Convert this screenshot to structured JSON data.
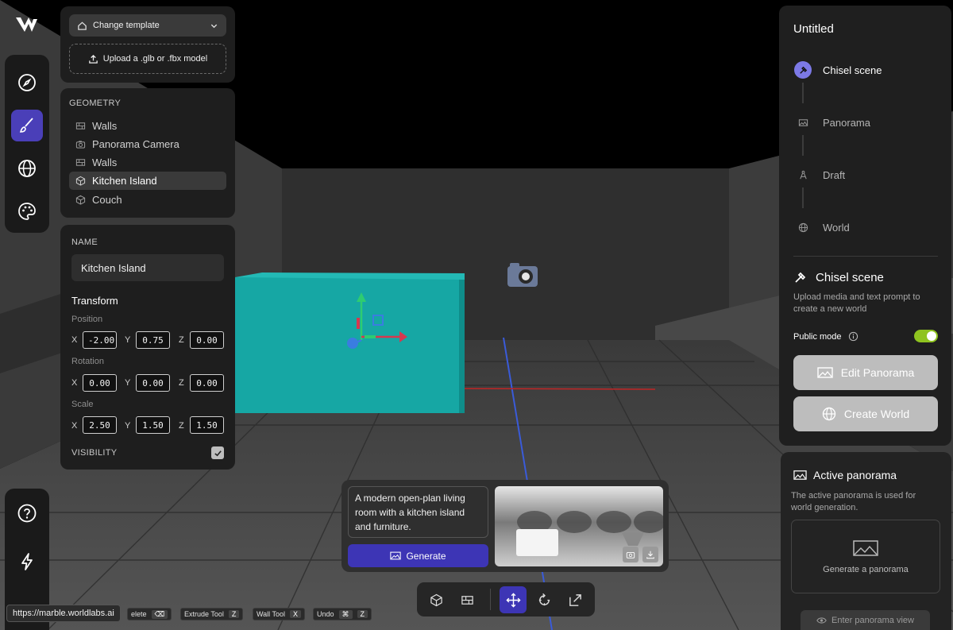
{
  "app": {
    "logo_icon": "worldlabs-logo-icon",
    "status_url": "https://marble.worldlabs.ai"
  },
  "rail_top": {
    "items": [
      {
        "icon": "compass-icon",
        "active": false
      },
      {
        "icon": "brush-icon",
        "active": true
      },
      {
        "icon": "globe-icon",
        "active": false
      },
      {
        "icon": "palette-icon",
        "active": false
      }
    ]
  },
  "rail_bottom": {
    "items": [
      {
        "icon": "help-icon"
      },
      {
        "icon": "lightning-icon"
      },
      {
        "icon": "avatar-gradient-icon"
      }
    ]
  },
  "template": {
    "change_template_label": "Change template",
    "upload_label": "Upload a .glb or .fbx model"
  },
  "geometry": {
    "heading": "GEOMETRY",
    "items": [
      {
        "label": "Walls",
        "icon": "wall-icon"
      },
      {
        "label": "Panorama Camera",
        "icon": "camera-icon"
      },
      {
        "label": "Walls",
        "icon": "wall-icon"
      },
      {
        "label": "Kitchen Island",
        "icon": "cube-icon",
        "selected": true
      },
      {
        "label": "Couch",
        "icon": "cube-icon"
      }
    ]
  },
  "inspector": {
    "name_label": "NAME",
    "name_value": "Kitchen Island",
    "transform_heading": "Transform",
    "position_label": "Position",
    "rotation_label": "Rotation",
    "scale_label": "Scale",
    "axis_x": "X",
    "axis_y": "Y",
    "axis_z": "Z",
    "position": {
      "x": "-2.00",
      "y": "0.75",
      "z": "0.00"
    },
    "rotation": {
      "x": "0.00",
      "y": "0.00",
      "z": "0.00"
    },
    "scale": {
      "x": "2.50",
      "y": "1.50",
      "z": "1.50"
    },
    "visibility_label": "VISIBILITY",
    "visibility_checked": true
  },
  "right_panel": {
    "title": "Untitled",
    "steps": [
      {
        "label": "Chisel scene",
        "icon": "chisel-icon",
        "active": true
      },
      {
        "label": "Panorama",
        "icon": "panorama-icon",
        "active": false
      },
      {
        "label": "Draft",
        "icon": "compass-draft-icon",
        "active": false
      },
      {
        "label": "World",
        "icon": "globe-icon",
        "active": false
      }
    ],
    "section_title": "Chisel scene",
    "section_desc": "Upload media and text prompt to create a new world",
    "public_mode_label": "Public mode",
    "public_mode_on": true,
    "edit_panorama_label": "Edit Panorama",
    "create_world_label": "Create World"
  },
  "active_panorama": {
    "title": "Active panorama",
    "desc": "The active panorama is used for world generation.",
    "generate_label": "Generate a panorama",
    "enter_view_label": "Enter panorama view"
  },
  "prompt": {
    "text": "A modern open-plan living room with a kitchen island and furniture.",
    "generate_label": "Generate"
  },
  "toolbar": {
    "tools": [
      {
        "icon": "cube-tool-icon",
        "active": false
      },
      {
        "icon": "wall-tool-icon",
        "active": false
      },
      {
        "icon": "move-tool-icon",
        "active": true
      },
      {
        "icon": "rotate-tool-icon",
        "active": false
      },
      {
        "icon": "scale-tool-icon",
        "active": false
      }
    ]
  },
  "shortcuts": [
    {
      "label": "Delete",
      "visible_label": "elete",
      "keys": [
        "⌫"
      ]
    },
    {
      "label": "Extrude Tool",
      "keys": [
        "Z"
      ]
    },
    {
      "label": "Wall Tool",
      "keys": [
        "X"
      ]
    },
    {
      "label": "Undo",
      "keys": [
        "⌘",
        "Z"
      ]
    }
  ],
  "colors": {
    "accent": "#3d35b5",
    "active_rail": "#4a3fb8",
    "toggle_on": "#8fc31f",
    "selected_object": "#17a3a0"
  }
}
